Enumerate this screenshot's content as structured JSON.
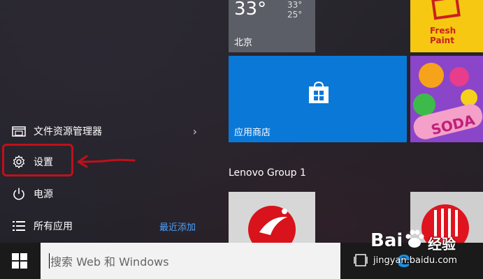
{
  "left_menu": {
    "file_explorer": "文件资源管理器",
    "settings": "设置",
    "power": "电源",
    "all_apps": "所有应用",
    "recently_added": "最近添加"
  },
  "tiles": {
    "weather": {
      "temp": "33°",
      "high": "33°",
      "low": "25°",
      "city": "北京"
    },
    "store": {
      "label": "应用商店"
    },
    "fresh_paint": {
      "label": "Fresh Paint"
    },
    "group_title": "Lenovo Group 1"
  },
  "taskbar": {
    "search_placeholder": "搜索 Web 和 Windows"
  },
  "watermark": {
    "brand": "Bai",
    "brand_cn": "经验",
    "url": "jingyan.baidu.com"
  },
  "colors": {
    "accent": "#0a78d7",
    "highlight": "#c0101a"
  }
}
